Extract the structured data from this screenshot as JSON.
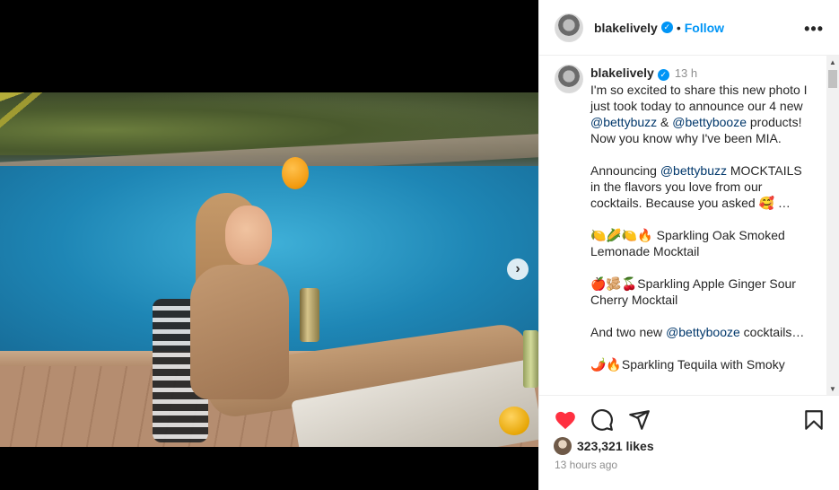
{
  "post": {
    "username": "blakelively",
    "follow_label": "Follow",
    "separator": "•",
    "more_label": "•••",
    "next_label": "›"
  },
  "caption": {
    "username": "blakelively",
    "time": "13 h",
    "lines": [
      "I'm so excited to share this new photo I just took today to announce our 4 new",
      "@bettybuzz",
      "&",
      "@bettybooze",
      "products!",
      "Now you know why I've been MIA.",
      "Announcing",
      "@bettybuzz",
      "MOCKTAILS in the flavors you love from our cocktails. Because you asked 🥰 …",
      "🍋🌽🍋🔥 Sparkling Oak Smoked Lemonade Mocktail",
      "🍎🫚🍒Sparkling Apple Ginger Sour Cherry Mocktail",
      "And two new",
      "@bettybooze",
      "cocktails…",
      "🌶️🔥Sparkling Tequila with Smoky"
    ]
  },
  "scroll": {
    "up": "▲",
    "down": "▼"
  },
  "engagement": {
    "likes": "323,321 likes",
    "posted": "13 hours ago"
  },
  "icons": {
    "like": "heart-icon",
    "comment": "comment-icon",
    "share": "share-icon",
    "save": "bookmark-icon"
  },
  "colors": {
    "like": "#ff3040",
    "link": "#0095f6",
    "mention": "#00376b"
  }
}
